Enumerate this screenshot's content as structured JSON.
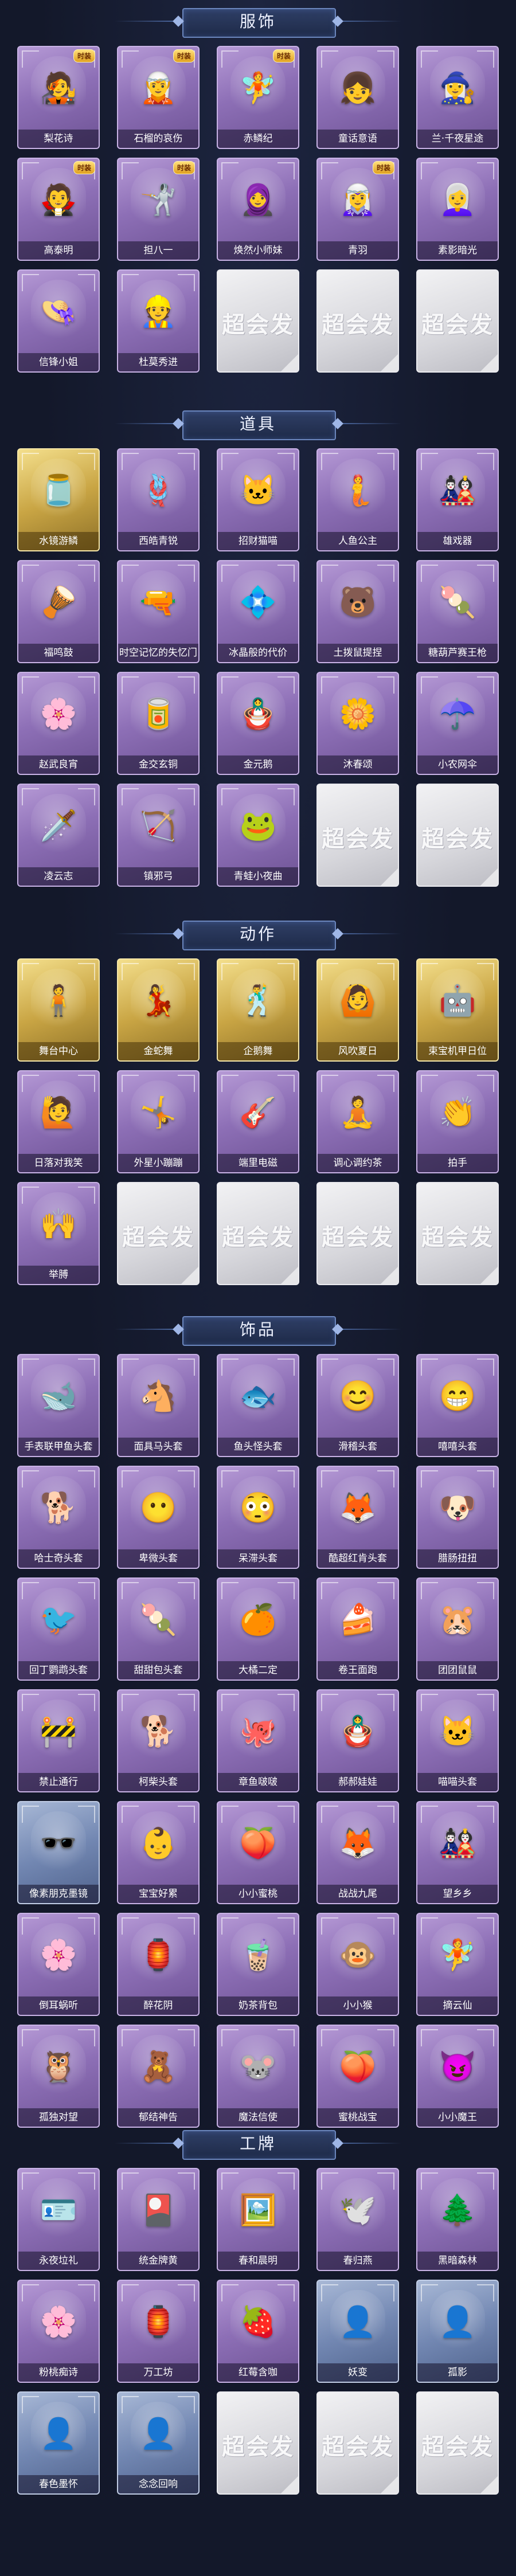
{
  "watermark": "超会发",
  "colors": {
    "background": "#13182a",
    "purple": "#a88cc9",
    "gold": "#d6b75a",
    "silver": "#dcdce0",
    "blue": "#7a8fb8",
    "header": "#2a3860"
  },
  "sections": [
    {
      "title": "服饰",
      "rows": 3,
      "items": [
        {
          "name": "梨花诗",
          "rarity": "purple",
          "icon": "🧑‍🎤",
          "badge": "时装"
        },
        {
          "name": "石榴的哀伤",
          "rarity": "purple",
          "icon": "🧝",
          "badge": "时装"
        },
        {
          "name": "赤鳞纪",
          "rarity": "purple",
          "icon": "🧚",
          "badge": "时装"
        },
        {
          "name": "童话意语",
          "rarity": "purple",
          "icon": "👧",
          "badge": ""
        },
        {
          "name": "兰·千夜星途",
          "rarity": "purple",
          "icon": "🧙‍♀️",
          "badge": ""
        },
        {
          "name": "高泰明",
          "rarity": "purple",
          "icon": "🧛",
          "badge": "时装"
        },
        {
          "name": "担八一",
          "rarity": "purple",
          "icon": "🤺",
          "badge": "时装"
        },
        {
          "name": "焕然小师妹",
          "rarity": "purple",
          "icon": "🧕",
          "badge": ""
        },
        {
          "name": "青羽",
          "rarity": "purple",
          "icon": "🧝‍♀️",
          "badge": "时装"
        },
        {
          "name": "素影暗光",
          "rarity": "purple",
          "icon": "👩‍🦳",
          "badge": ""
        },
        {
          "name": "信锋小姐",
          "rarity": "purple",
          "icon": "👒",
          "badge": ""
        },
        {
          "name": "杜莫秀进",
          "rarity": "purple",
          "icon": "👷",
          "badge": ""
        },
        {
          "name": "",
          "rarity": "empty",
          "icon": "",
          "badge": ""
        },
        {
          "name": "",
          "rarity": "empty",
          "icon": "",
          "badge": ""
        },
        {
          "name": "",
          "rarity": "empty",
          "icon": "",
          "badge": ""
        }
      ]
    },
    {
      "title": "道具",
      "rows": 4,
      "items": [
        {
          "name": "水镜游鳞",
          "rarity": "gold",
          "icon": "🫙",
          "badge": ""
        },
        {
          "name": "西皓青锐",
          "rarity": "purple",
          "icon": "🪢",
          "badge": ""
        },
        {
          "name": "招财猫喵",
          "rarity": "purple",
          "icon": "🐱",
          "badge": ""
        },
        {
          "name": "人鱼公主",
          "rarity": "purple",
          "icon": "🧜",
          "badge": ""
        },
        {
          "name": "雄戏器",
          "rarity": "purple",
          "icon": "🎎",
          "badge": ""
        },
        {
          "name": "福鸣鼓",
          "rarity": "purple",
          "icon": "🪘",
          "badge": ""
        },
        {
          "name": "时空记忆的失忆门",
          "rarity": "purple",
          "icon": "🔫",
          "badge": ""
        },
        {
          "name": "冰晶般的代价",
          "rarity": "purple",
          "icon": "💠",
          "badge": ""
        },
        {
          "name": "土拨鼠提捏",
          "rarity": "purple",
          "icon": "🐻",
          "badge": ""
        },
        {
          "name": "糖葫芦赛王枪",
          "rarity": "purple",
          "icon": "🍡",
          "badge": ""
        },
        {
          "name": "赵武良宵",
          "rarity": "purple",
          "icon": "🌸",
          "badge": ""
        },
        {
          "name": "金交玄铜",
          "rarity": "purple",
          "icon": "🥫",
          "badge": ""
        },
        {
          "name": "金元鹅",
          "rarity": "purple",
          "icon": "🪆",
          "badge": ""
        },
        {
          "name": "沐春颂",
          "rarity": "purple",
          "icon": "🌼",
          "badge": ""
        },
        {
          "name": "小农网伞",
          "rarity": "purple",
          "icon": "☂️",
          "badge": ""
        },
        {
          "name": "凌云志",
          "rarity": "purple",
          "icon": "🗡️",
          "badge": ""
        },
        {
          "name": "镇邪弓",
          "rarity": "purple",
          "icon": "🏹",
          "badge": ""
        },
        {
          "name": "青蛙小夜曲",
          "rarity": "purple",
          "icon": "🐸",
          "badge": ""
        },
        {
          "name": "",
          "rarity": "empty",
          "icon": "",
          "badge": ""
        },
        {
          "name": "",
          "rarity": "empty",
          "icon": "",
          "badge": ""
        }
      ]
    },
    {
      "title": "动作",
      "rows": 3,
      "items": [
        {
          "name": "舞台中心",
          "rarity": "gold",
          "icon": "🧍",
          "badge": ""
        },
        {
          "name": "金蛇舞",
          "rarity": "gold",
          "icon": "💃",
          "badge": ""
        },
        {
          "name": "企鹅舞",
          "rarity": "gold",
          "icon": "🕺",
          "badge": ""
        },
        {
          "name": "风吹夏日",
          "rarity": "gold",
          "icon": "🙆",
          "badge": ""
        },
        {
          "name": "束宝机甲日位",
          "rarity": "gold",
          "icon": "🤖",
          "badge": ""
        },
        {
          "name": "日落对我笑",
          "rarity": "purple",
          "icon": "🙋",
          "badge": ""
        },
        {
          "name": "外星小蹦蹦",
          "rarity": "purple",
          "icon": "🤸",
          "badge": ""
        },
        {
          "name": "端里电磁",
          "rarity": "purple",
          "icon": "🎸",
          "badge": ""
        },
        {
          "name": "调心调约茶",
          "rarity": "purple",
          "icon": "🧘",
          "badge": ""
        },
        {
          "name": "拍手",
          "rarity": "purple",
          "icon": "👏",
          "badge": ""
        },
        {
          "name": "举膊",
          "rarity": "purple",
          "icon": "🙌",
          "badge": ""
        },
        {
          "name": "",
          "rarity": "empty",
          "icon": "",
          "badge": ""
        },
        {
          "name": "",
          "rarity": "empty",
          "icon": "",
          "badge": ""
        },
        {
          "name": "",
          "rarity": "empty",
          "icon": "",
          "badge": ""
        },
        {
          "name": "",
          "rarity": "empty",
          "icon": "",
          "badge": ""
        }
      ]
    },
    {
      "title": "饰品",
      "rows": 7,
      "items": [
        {
          "name": "手表联甲鱼头套",
          "rarity": "purple",
          "icon": "🐋",
          "badge": ""
        },
        {
          "name": "面具马头套",
          "rarity": "purple",
          "icon": "🐴",
          "badge": ""
        },
        {
          "name": "鱼头怪头套",
          "rarity": "purple",
          "icon": "🐟",
          "badge": ""
        },
        {
          "name": "滑稽头套",
          "rarity": "purple",
          "icon": "😊",
          "badge": ""
        },
        {
          "name": "嘻嘻头套",
          "rarity": "purple",
          "icon": "😁",
          "badge": ""
        },
        {
          "name": "哈士奇头套",
          "rarity": "purple",
          "icon": "🐕",
          "badge": ""
        },
        {
          "name": "卑微头套",
          "rarity": "purple",
          "icon": "😶",
          "badge": ""
        },
        {
          "name": "呆滞头套",
          "rarity": "purple",
          "icon": "😳",
          "badge": ""
        },
        {
          "name": "酷超红肯头套",
          "rarity": "purple",
          "icon": "🦊",
          "badge": ""
        },
        {
          "name": "腊肠扭扭",
          "rarity": "purple",
          "icon": "🐶",
          "badge": ""
        },
        {
          "name": "回丁鹦鹉头套",
          "rarity": "purple",
          "icon": "🐦",
          "badge": ""
        },
        {
          "name": "甜甜包头套",
          "rarity": "purple",
          "icon": "🍡",
          "badge": ""
        },
        {
          "name": "大橘二定",
          "rarity": "purple",
          "icon": "🍊",
          "badge": ""
        },
        {
          "name": "卷王面跑",
          "rarity": "purple",
          "icon": "🍰",
          "badge": ""
        },
        {
          "name": "团团鼠鼠",
          "rarity": "purple",
          "icon": "🐹",
          "badge": ""
        },
        {
          "name": "禁止通行",
          "rarity": "purple",
          "icon": "🚧",
          "badge": ""
        },
        {
          "name": "柯柴头套",
          "rarity": "purple",
          "icon": "🐕",
          "badge": ""
        },
        {
          "name": "章鱼啵啵",
          "rarity": "purple",
          "icon": "🐙",
          "badge": ""
        },
        {
          "name": "郝郝娃娃",
          "rarity": "purple",
          "icon": "🪆",
          "badge": ""
        },
        {
          "name": "喵喵头套",
          "rarity": "purple",
          "icon": "🐱",
          "badge": ""
        },
        {
          "name": "像素朋克墨镜",
          "rarity": "blue",
          "icon": "🕶️",
          "badge": ""
        },
        {
          "name": "宝宝好累",
          "rarity": "purple",
          "icon": "👶",
          "badge": ""
        },
        {
          "name": "小小蜜桃",
          "rarity": "purple",
          "icon": "🍑",
          "badge": ""
        },
        {
          "name": "战战九尾",
          "rarity": "purple",
          "icon": "🦊",
          "badge": ""
        },
        {
          "name": "望乡乡",
          "rarity": "purple",
          "icon": "🎎",
          "badge": ""
        },
        {
          "name": "倒耳蜗听",
          "rarity": "purple",
          "icon": "🌸",
          "badge": ""
        },
        {
          "name": "醉花阴",
          "rarity": "purple",
          "icon": "🏮",
          "badge": ""
        },
        {
          "name": "奶茶背包",
          "rarity": "purple",
          "icon": "🧋",
          "badge": ""
        },
        {
          "name": "小小猴",
          "rarity": "purple",
          "icon": "🐵",
          "badge": ""
        },
        {
          "name": "摘云仙",
          "rarity": "purple",
          "icon": "🧚",
          "badge": ""
        },
        {
          "name": "孤独对望",
          "rarity": "purple",
          "icon": "🦉",
          "badge": ""
        },
        {
          "name": "郁结神告",
          "rarity": "purple",
          "icon": "🧸",
          "badge": ""
        },
        {
          "name": "魔法信使",
          "rarity": "purple",
          "icon": "🐭",
          "badge": ""
        },
        {
          "name": "蜜桃战宝",
          "rarity": "purple",
          "icon": "🍑",
          "badge": ""
        },
        {
          "name": "小小魔王",
          "rarity": "purple",
          "icon": "😈",
          "badge": ""
        }
      ]
    },
    {
      "title": "工牌",
      "rows": 3,
      "items": [
        {
          "name": "永夜垃礼",
          "rarity": "purple",
          "icon": "🪪",
          "badge": ""
        },
        {
          "name": "统金牌黄",
          "rarity": "purple",
          "icon": "🎴",
          "badge": ""
        },
        {
          "name": "春和晨明",
          "rarity": "purple",
          "icon": "🖼️",
          "badge": ""
        },
        {
          "name": "春归燕",
          "rarity": "purple",
          "icon": "🕊️",
          "badge": ""
        },
        {
          "name": "黑暗森林",
          "rarity": "purple",
          "icon": "🌲",
          "badge": ""
        },
        {
          "name": "粉桃痴诗",
          "rarity": "purple",
          "icon": "🌸",
          "badge": ""
        },
        {
          "name": "万工坊",
          "rarity": "purple",
          "icon": "🏮",
          "badge": ""
        },
        {
          "name": "红莓含咖",
          "rarity": "purple",
          "icon": "🍓",
          "badge": ""
        },
        {
          "name": "妖变",
          "rarity": "blue",
          "icon": "👤",
          "badge": ""
        },
        {
          "name": "孤影",
          "rarity": "blue",
          "icon": "👤",
          "badge": ""
        },
        {
          "name": "春色墨怀",
          "rarity": "blue",
          "icon": "👤",
          "badge": ""
        },
        {
          "name": "念念回响",
          "rarity": "blue",
          "icon": "👤",
          "badge": ""
        },
        {
          "name": "",
          "rarity": "empty",
          "icon": "",
          "badge": ""
        },
        {
          "name": "",
          "rarity": "empty",
          "icon": "",
          "badge": ""
        },
        {
          "name": "",
          "rarity": "empty",
          "icon": "",
          "badge": ""
        }
      ]
    }
  ]
}
